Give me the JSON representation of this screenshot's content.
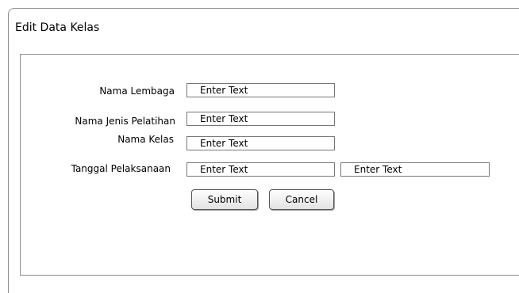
{
  "window": {
    "title": "Edit Data Kelas"
  },
  "form": {
    "nama_lembaga": {
      "label": "Nama Lembaga",
      "value": "Enter Text"
    },
    "nama_jenis_pelatihan": {
      "label": "Nama Jenis Pelatihan",
      "value": "Enter Text"
    },
    "nama_kelas": {
      "label": "Nama Kelas",
      "value": "Enter Text"
    },
    "tanggal_pelaksanaan": {
      "label": "Tanggal Pelaksanaan",
      "start_value": "Enter Text",
      "end_value": "Enter Text"
    }
  },
  "buttons": {
    "submit_label": "Submit",
    "cancel_label": "Cancel"
  },
  "colors": {
    "border": "#8c8c8c",
    "input_border": "#777777",
    "button_top": "#ffffff",
    "button_bottom": "#e2e2e2"
  }
}
